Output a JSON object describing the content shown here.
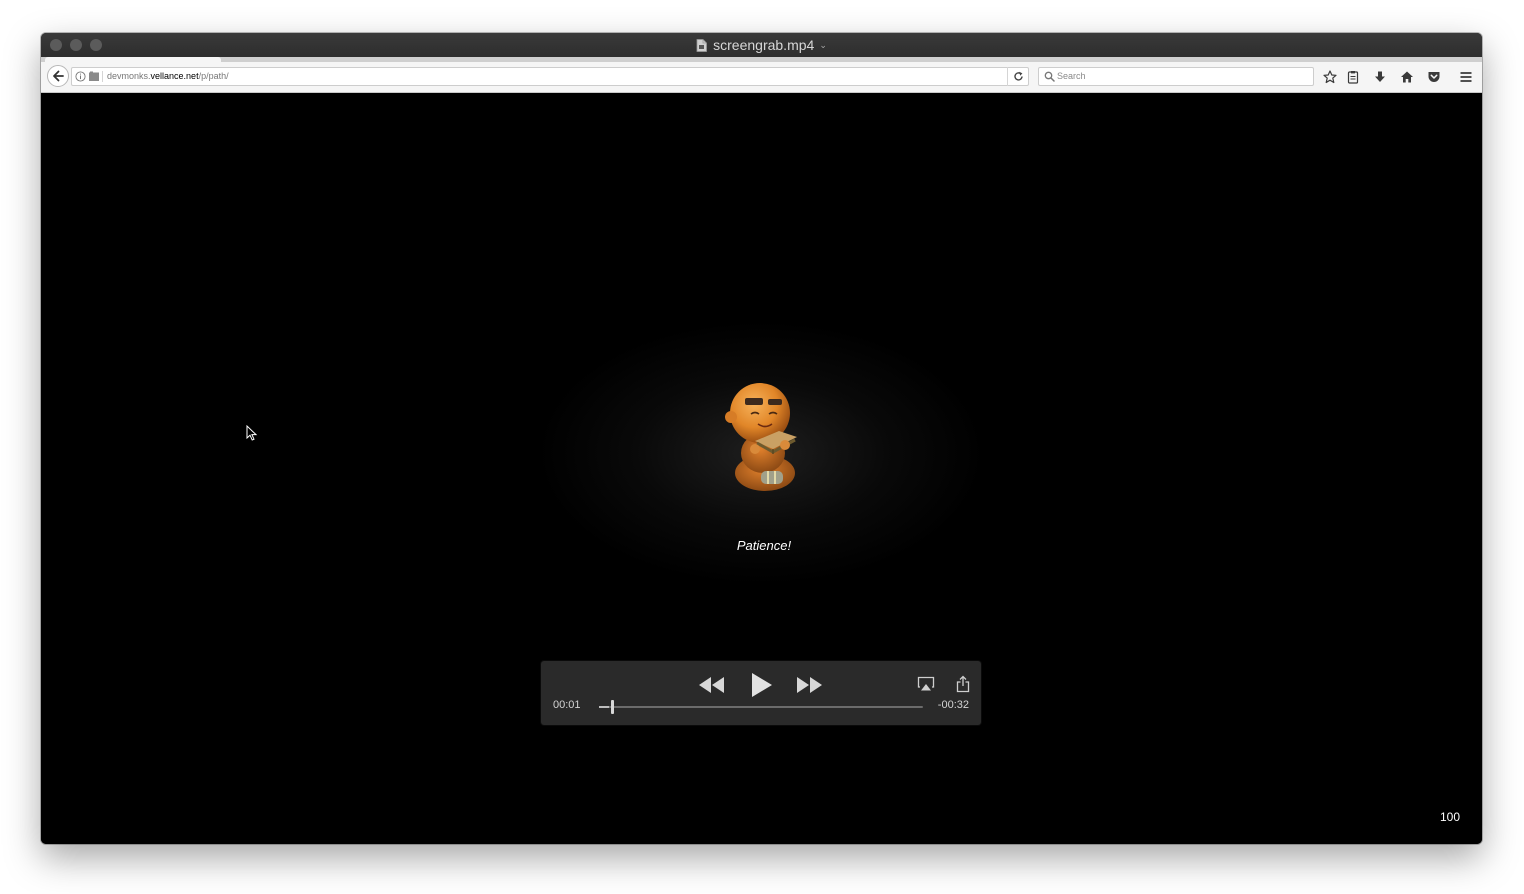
{
  "window": {
    "title": "screengrab.mp4"
  },
  "toolbar": {
    "url_host_prefix": "devmonks.",
    "url_host": "vellance.net",
    "url_path": "/p/path/",
    "search_placeholder": "Search"
  },
  "video": {
    "caption": "Patience!",
    "time_current": "00:01",
    "time_remaining": "-00:32",
    "progress_fraction": 0.03,
    "zoom_level": "100"
  },
  "icons": {
    "file": "file-icon",
    "back": "back-arrow-icon",
    "info": "info-icon",
    "page": "page-icon",
    "reload": "reload-icon",
    "search": "search-icon",
    "bookmark": "star-icon",
    "reading_list": "clipboard-icon",
    "downloads": "download-arrow-icon",
    "home": "home-icon",
    "pocket": "pocket-icon",
    "menu": "hamburger-menu-icon",
    "rewind": "rewind-icon",
    "play": "play-icon",
    "fast_forward": "fast-forward-icon",
    "airplay": "airplay-icon",
    "share": "share-icon",
    "cursor": "mouse-pointer-icon"
  }
}
